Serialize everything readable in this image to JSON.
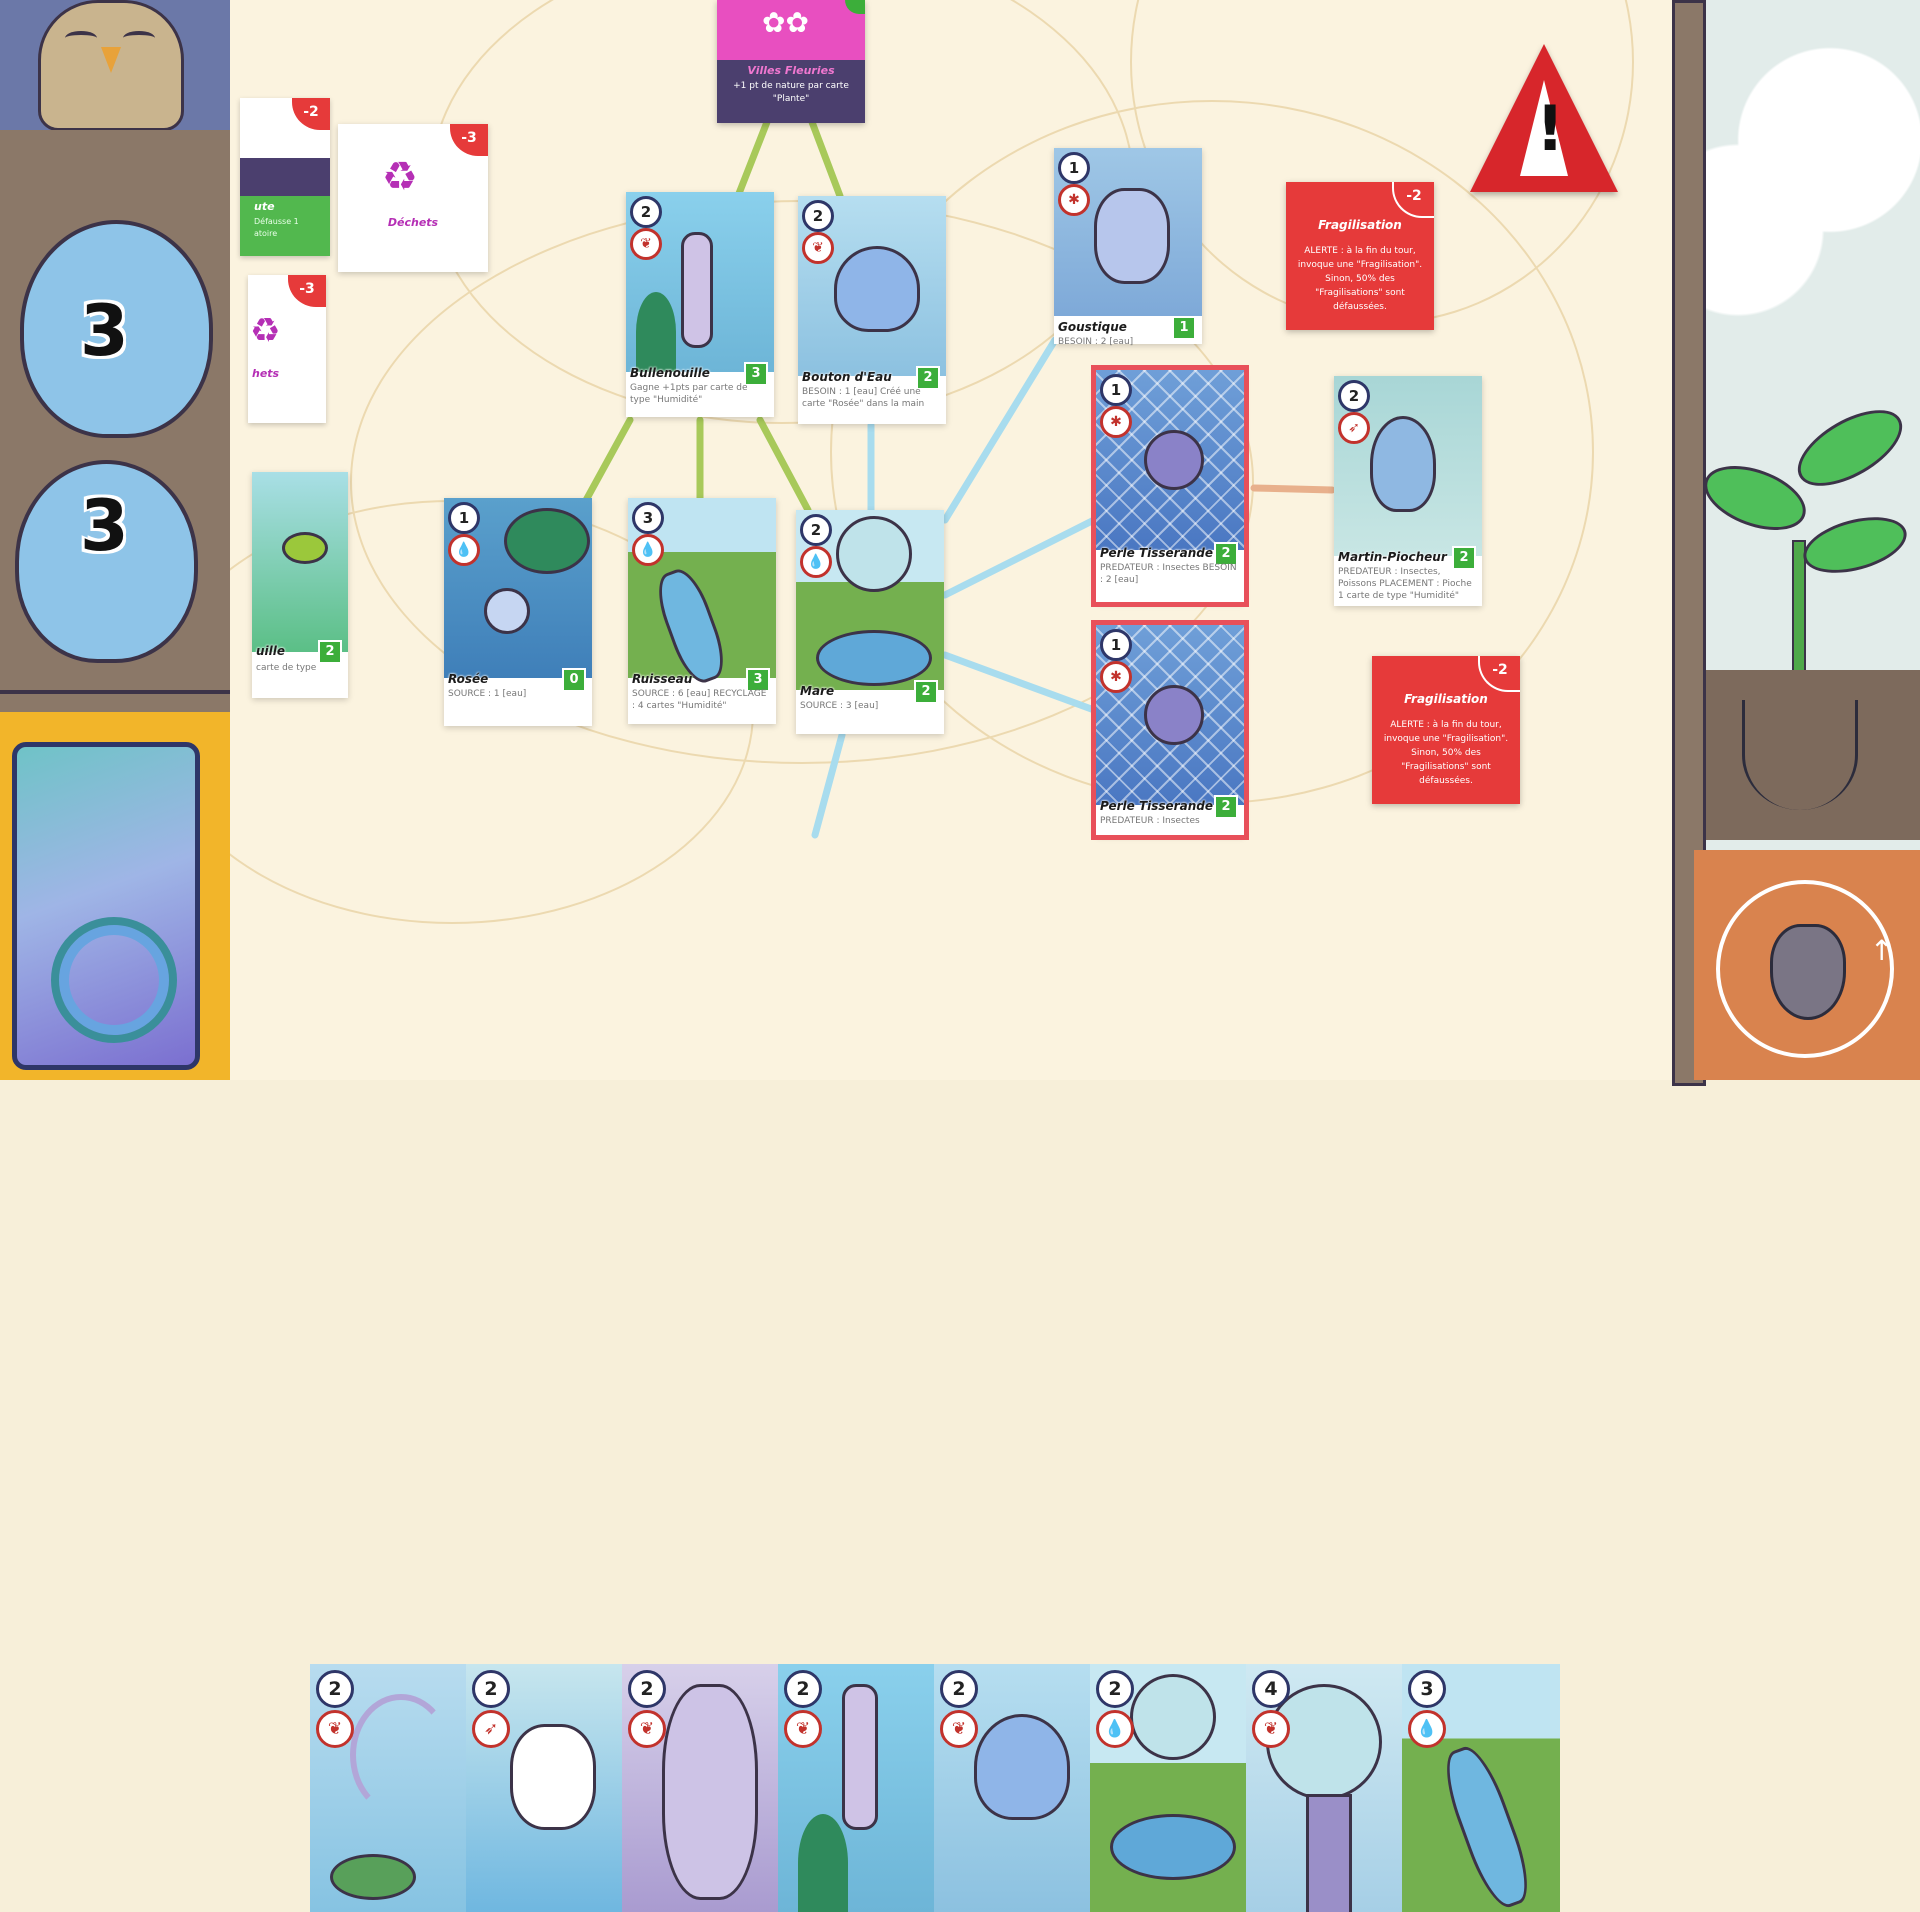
{
  "left_panel": {
    "counter_top": "3",
    "counter_bottom": "3"
  },
  "objective_card": {
    "title": "Villes Fleuries",
    "description": "+1 pt de nature par carte \"Plante\""
  },
  "waste_cards": [
    {
      "penalty": "-2",
      "label": "ute",
      "desc": "Défausse 1 atoire"
    },
    {
      "penalty": "-3",
      "label": "Déchets"
    },
    {
      "penalty": "-3",
      "label": "hets"
    }
  ],
  "board_cards": [
    {
      "id": "bullenouille",
      "cost": "2",
      "type_icon": "leaf",
      "name": "Bullenouille",
      "score": "3",
      "desc": "Gagne +1pts par carte de type \"Humidité\""
    },
    {
      "id": "bouton",
      "cost": "2",
      "type_icon": "leaf",
      "name": "Bouton d'Eau",
      "score": "2",
      "desc": "BESOIN : 1 [eau] Créé une carte \"Rosée\" dans la main"
    },
    {
      "id": "goustique",
      "cost": "1",
      "type_icon": "bug",
      "name": "Goustique",
      "score": "1",
      "desc": "BESOIN : 2 [eau]"
    },
    {
      "id": "perle1",
      "cost": "1",
      "type_icon": "bug",
      "name": "Perle Tisserande",
      "score": "2",
      "desc": "PREDATEUR : Insectes BESOIN : 2 [eau]"
    },
    {
      "id": "martin",
      "cost": "2",
      "type_icon": "bird",
      "name": "Martin-Piocheur",
      "score": "2",
      "desc": "PREDATEUR : Insectes, Poissons PLACEMENT : Pioche 1 carte de type \"Humidité\""
    },
    {
      "id": "rosee",
      "cost": "1",
      "type_icon": "drop",
      "name": "Rosée",
      "score": "0",
      "desc": "SOURCE : 1 [eau]"
    },
    {
      "id": "ruisseau",
      "cost": "3",
      "type_icon": "drop",
      "name": "Ruisseau",
      "score": "3",
      "desc": "SOURCE : 6 [eau] RECYCLAGE : 4 cartes \"Humidité\""
    },
    {
      "id": "mare",
      "cost": "2",
      "type_icon": "drop",
      "name": "Mare",
      "score": "2",
      "desc": "SOURCE : 3 [eau]"
    },
    {
      "id": "perle2",
      "cost": "1",
      "type_icon": "bug",
      "name": "Perle Tisserande",
      "score": "2",
      "desc": "PREDATEUR : Insectes"
    },
    {
      "id": "partial",
      "cost": "",
      "type_icon": "",
      "name": "uille",
      "score": "2",
      "desc": "carte de type"
    }
  ],
  "alerts": [
    {
      "penalty": "-2",
      "title": "Fragilisation",
      "text": "ALERTE : à la fin du tour, invoque une \"Fragilisation\". Sinon, 50% des \"Fragilisations\" sont défaussées."
    },
    {
      "penalty": "-2",
      "title": "Fragilisation",
      "text": "ALERTE : à la fin du tour, invoque une \"Fragilisation\". Sinon, 50% des \"Fragilisations\" sont défaussées."
    }
  ],
  "hand": [
    {
      "cost": "2",
      "type_icon": "leaf"
    },
    {
      "cost": "2",
      "type_icon": "bird"
    },
    {
      "cost": "2",
      "type_icon": "leaf"
    },
    {
      "cost": "2",
      "type_icon": "leaf"
    },
    {
      "cost": "2",
      "type_icon": "leaf"
    },
    {
      "cost": "2",
      "type_icon": "drop"
    },
    {
      "cost": "4",
      "type_icon": "leaf"
    },
    {
      "cost": "3",
      "type_icon": "drop"
    }
  ],
  "colors": {
    "board": "#fbf3df",
    "alert_red": "#e63a3a",
    "score_green": "#3cae3a",
    "objective_pink": "#e84fc0",
    "objective_purple": "#4b3f6e",
    "link_green": "#a8c95a",
    "link_blue": "#a8dcee",
    "selected_red": "#e8505a",
    "deck_yellow": "#f2b52a",
    "endturn_orange": "#d9834e"
  },
  "icons": {
    "leaf": "leaf-icon",
    "drop": "water-drop-icon",
    "bug": "insect-icon",
    "bird": "bird-icon",
    "warning": "warning-triangle-icon",
    "end_turn": "end-turn-icon"
  }
}
